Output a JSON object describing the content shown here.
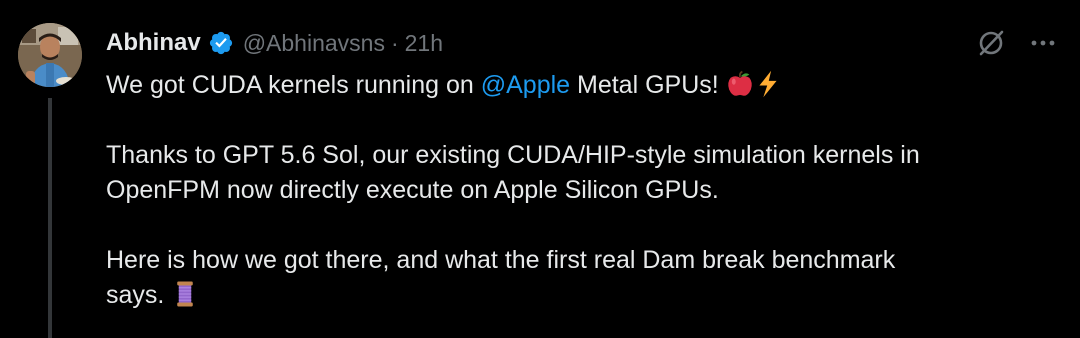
{
  "author": {
    "display_name": "Abhinav",
    "handle": "@Abhinavsns",
    "separator": "·",
    "time": "21h",
    "verified_color": "#1d9bf0"
  },
  "icons": {
    "avatar": "profile-photo",
    "verified": "verified-badge-icon",
    "grok": "grok-icon",
    "more": "more-horizontal-icon",
    "apple_emoji": "red-apple-emoji",
    "lightning_emoji": "high-voltage-emoji",
    "thread_emoji": "thread-spool-emoji"
  },
  "colors": {
    "background": "#000000",
    "text": "#e7e9ea",
    "secondary": "#71767b",
    "link": "#1d9bf0",
    "thread_line": "#333639"
  },
  "tweet": {
    "line1_before": "We got CUDA kernels running on ",
    "mention": "@Apple",
    "line1_after": " Metal GPUs! ",
    "para2_line1": "Thanks to GPT 5.6 Sol, our existing CUDA/HIP-style simulation kernels in",
    "para2_line2": "OpenFPM now directly execute on Apple Silicon GPUs.",
    "para3_line1": "Here is how we got there, and what the first real Dam break benchmark",
    "para3_line2": "says. "
  }
}
